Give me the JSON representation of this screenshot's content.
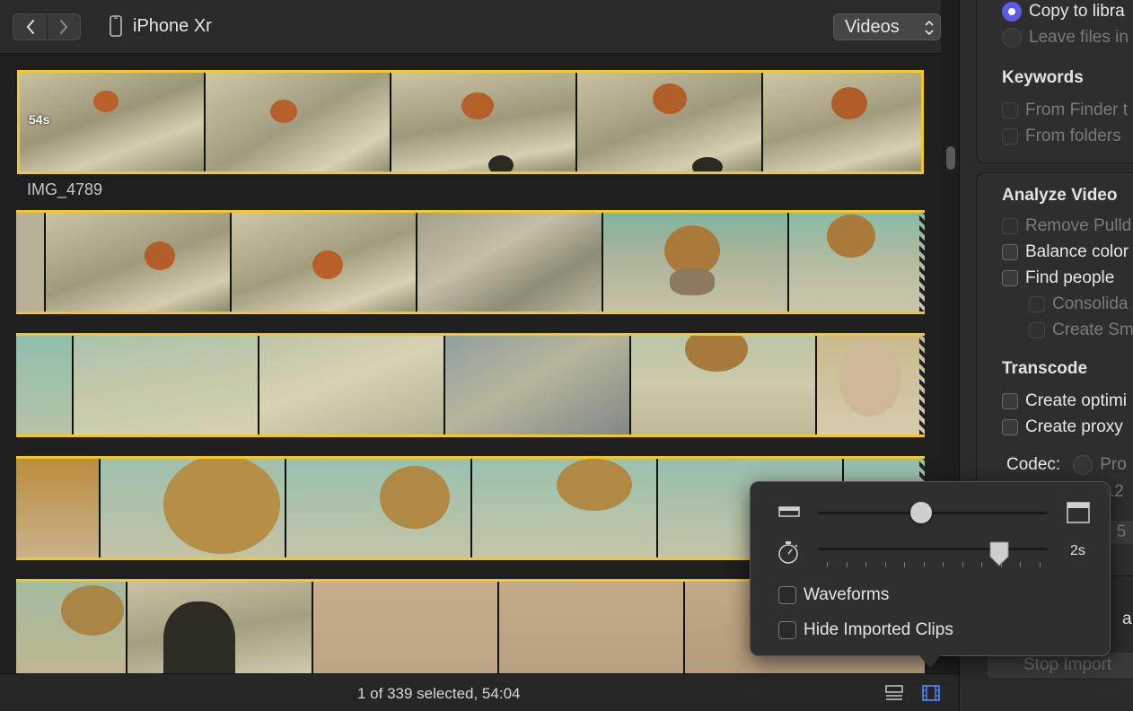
{
  "toolbar": {
    "device_name": "iPhone Xr",
    "view_select": "Videos"
  },
  "browser": {
    "first_clip": {
      "duration": "54s",
      "name": "IMG_4789"
    }
  },
  "statusbar": {
    "selection_text": "1 of 339 selected, 54:04"
  },
  "popover": {
    "clip_height_value": 0.45,
    "duration_value": "2s",
    "waveforms_label": "Waveforms",
    "waveforms_checked": false,
    "hide_imported_label": "Hide Imported Clips",
    "hide_imported_checked": false
  },
  "import_options": {
    "copy_label": "Copy to libra",
    "leave_label": "Leave files in",
    "keywords_head": "Keywords",
    "from_finder_label": "From Finder t",
    "from_folders_label": "From folders",
    "analyze_head": "Analyze Video",
    "remove_pulldown_label": "Remove Pulld",
    "balance_color_label": "Balance color",
    "find_people_label": "Find people",
    "consolidate_label": "Consolida",
    "create_smart_label": "Create Sm",
    "transcode_head": "Transcode",
    "create_optimized_label": "Create optimi",
    "create_proxy_label": "Create proxy",
    "codec_label": "Codec:",
    "codec_option": "Pro",
    "codec_sub": ".2",
    "codec_num": "5",
    "partial_a": "a",
    "stop_import_label": "Stop Import"
  },
  "colors": {
    "accent_selection": "#f3c824",
    "radio_accent": "#5b5ce2"
  }
}
